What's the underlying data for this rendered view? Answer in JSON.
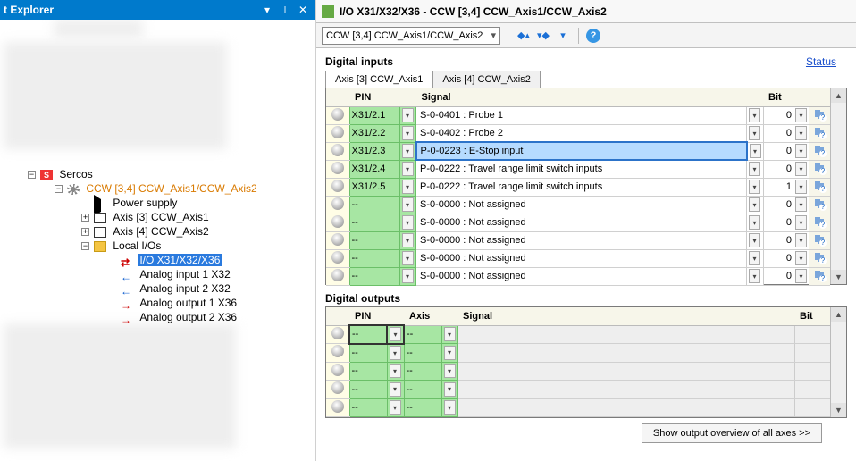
{
  "explorer": {
    "title": "t Explorer",
    "tree": {
      "sercos": "Sercos",
      "ccw": "CCW [3,4] CCW_Axis1/CCW_Axis2",
      "power": "Power supply",
      "axis3": "Axis [3] CCW_Axis1",
      "axis4": "Axis [4] CCW_Axis2",
      "localios": "Local I/Os",
      "io_sel": "I/O X31/X32/X36",
      "ai1": "Analog input 1 X32",
      "ai2": "Analog input 2 X32",
      "ao1": "Analog output 1 X36",
      "ao2": "Analog output 2 X36"
    }
  },
  "doc": {
    "title": "I/O X31/X32/X36 - CCW [3,4] CCW_Axis1/CCW_Axis2"
  },
  "toolbar": {
    "combo": "CCW [3,4] CCW_Axis1/CCW_Axis2"
  },
  "inputs": {
    "section_title": "Digital inputs",
    "status_link": "Status",
    "tabs": [
      "Axis [3] CCW_Axis1",
      "Axis [4] CCW_Axis2"
    ],
    "cols": {
      "pin": "PIN",
      "signal": "Signal",
      "bit": "Bit"
    },
    "rows": [
      {
        "pin": "X31/2.1",
        "signal": "S-0-0401 :  Probe 1",
        "bit": "0",
        "sel": false
      },
      {
        "pin": "X31/2.2",
        "signal": "S-0-0402 :  Probe 2",
        "bit": "0",
        "sel": false
      },
      {
        "pin": "X31/2.3",
        "signal": "P-0-0223 :  E-Stop input",
        "bit": "0",
        "sel": true
      },
      {
        "pin": "X31/2.4",
        "signal": "P-0-0222 :  Travel range limit switch inputs",
        "bit": "0",
        "sel": false
      },
      {
        "pin": "X31/2.5",
        "signal": "P-0-0222 :  Travel range limit switch inputs",
        "bit": "1",
        "sel": false
      },
      {
        "pin": "--",
        "signal": "S-0-0000 :  Not assigned",
        "bit": "0",
        "sel": false
      },
      {
        "pin": "--",
        "signal": "S-0-0000 :  Not assigned",
        "bit": "0",
        "sel": false
      },
      {
        "pin": "--",
        "signal": "S-0-0000 :  Not assigned",
        "bit": "0",
        "sel": false
      },
      {
        "pin": "--",
        "signal": "S-0-0000 :  Not assigned",
        "bit": "0",
        "sel": false
      },
      {
        "pin": "--",
        "signal": "S-0-0000 :  Not assigned",
        "bit": "0",
        "sel": false
      }
    ]
  },
  "outputs": {
    "section_title": "Digital outputs",
    "cols": {
      "pin": "PIN",
      "axis": "Axis",
      "signal": "Signal",
      "bit": "Bit"
    },
    "rows": [
      {
        "pin": "--",
        "axis": "--",
        "signal": "",
        "bit": "",
        "psel": true
      },
      {
        "pin": "--",
        "axis": "--",
        "signal": "",
        "bit": "",
        "psel": false
      },
      {
        "pin": "--",
        "axis": "--",
        "signal": "",
        "bit": "",
        "psel": false
      },
      {
        "pin": "--",
        "axis": "--",
        "signal": "",
        "bit": "",
        "psel": false
      },
      {
        "pin": "--",
        "axis": "--",
        "signal": "",
        "bit": "",
        "psel": false
      }
    ]
  },
  "footer": {
    "overview_btn": "Show output overview of all axes >>"
  }
}
